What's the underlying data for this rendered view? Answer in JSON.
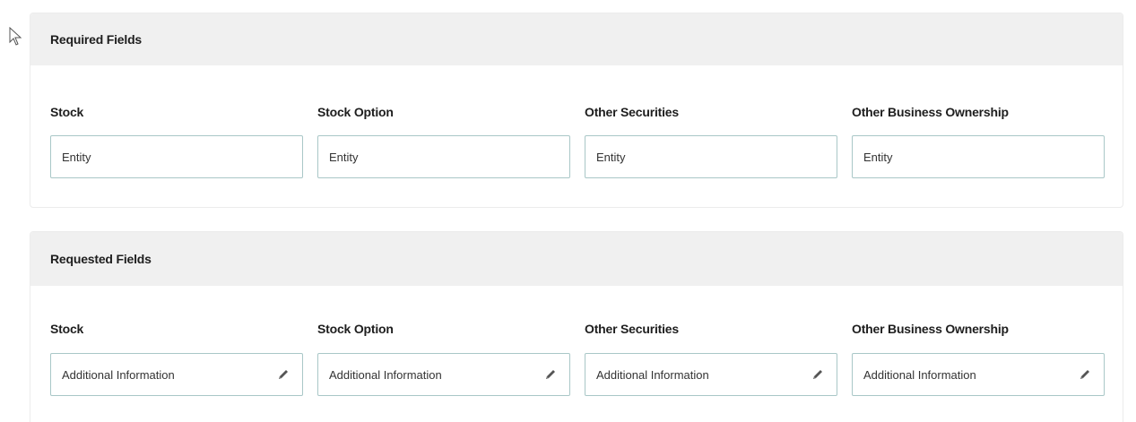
{
  "required": {
    "title": "Required Fields",
    "fields": [
      {
        "label": "Stock",
        "value": "Entity"
      },
      {
        "label": "Stock Option",
        "value": "Entity"
      },
      {
        "label": "Other Securities",
        "value": "Entity"
      },
      {
        "label": "Other Business Ownership",
        "value": "Entity"
      }
    ]
  },
  "requested": {
    "title": "Requested Fields",
    "fields": [
      {
        "label": "Stock",
        "value": "Additional Information",
        "icon": "pencil-icon"
      },
      {
        "label": "Stock Option",
        "value": "Additional Information",
        "icon": "pencil-icon"
      },
      {
        "label": "Other Securities",
        "value": "Additional Information",
        "icon": "pencil-icon"
      },
      {
        "label": "Other Business Ownership",
        "value": "Additional Information",
        "icon": "pencil-icon"
      }
    ]
  },
  "colors": {
    "header_bg": "#f0f0f0",
    "input_border": "#a9c7c7"
  }
}
